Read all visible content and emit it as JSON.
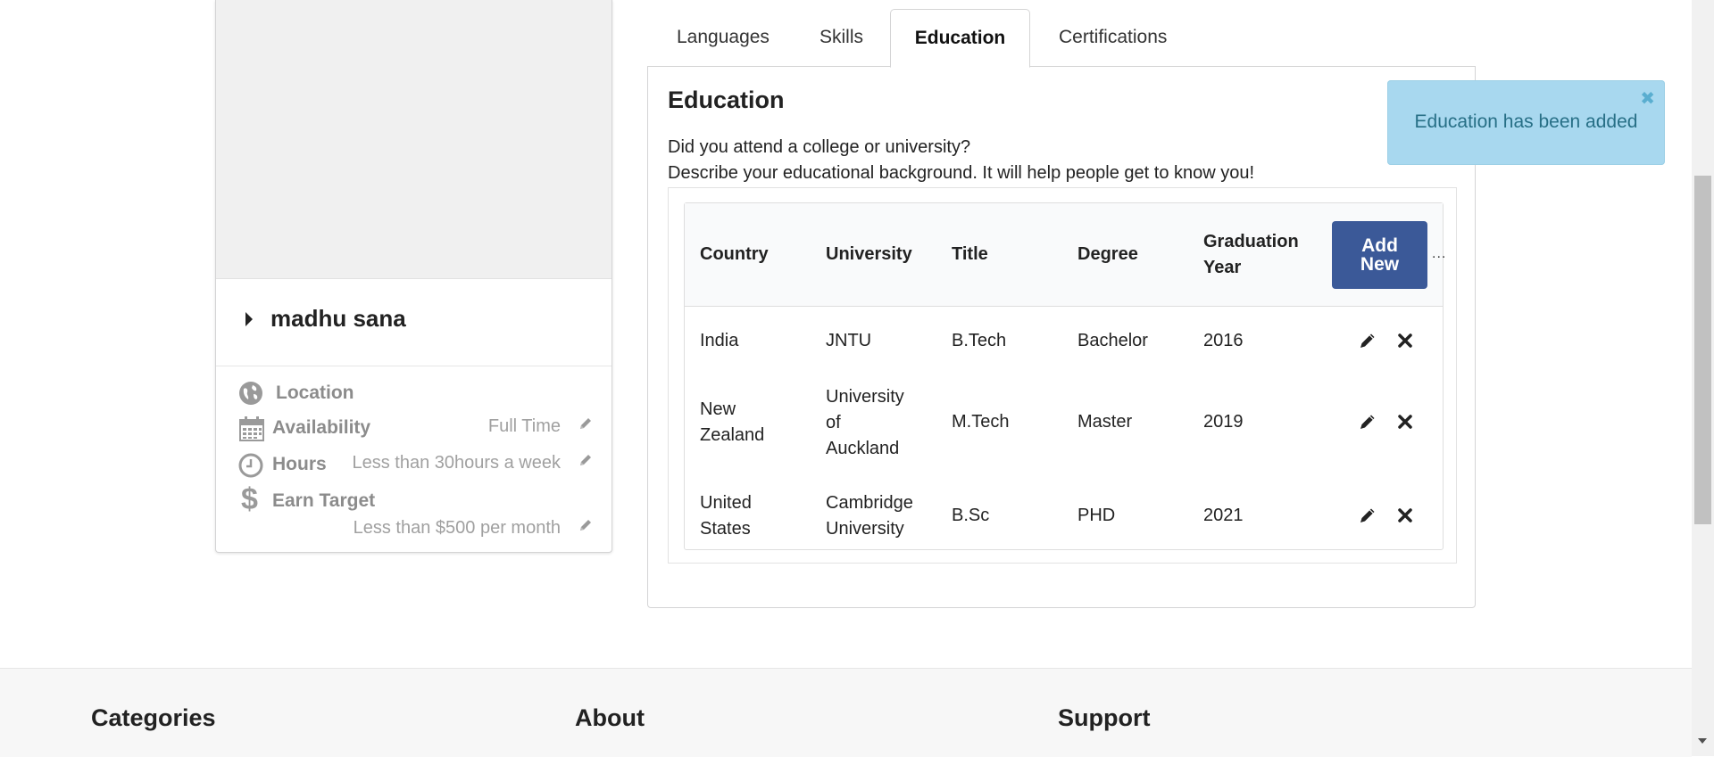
{
  "profile": {
    "name": "madhu sana",
    "location_label": "Location",
    "availability_label": "Availability",
    "availability_value": "Full Time",
    "hours_label": "Hours",
    "hours_value": "Less than 30hours a week",
    "earn_label": "Earn Target",
    "earn_value": "Less than $500 per month"
  },
  "tabs": [
    {
      "label": "Languages"
    },
    {
      "label": "Skills"
    },
    {
      "label": "Education"
    },
    {
      "label": "Certifications"
    }
  ],
  "education": {
    "title": "Education",
    "question": "Did you attend a college or university?",
    "description": "Describe your educational background. It will help people get to know you!",
    "add_button_line1": "Add",
    "add_button_line2": "New",
    "columns": {
      "country": "Country",
      "university": "University",
      "title": "Title",
      "degree": "Degree",
      "year_line1": "Graduation",
      "year_line2": "Year"
    },
    "overflow": "...",
    "rows": [
      {
        "country_l1": "India",
        "country_l2": "",
        "uni_l1": "JNTU",
        "uni_l2": "",
        "uni_l3": "",
        "title": "B.Tech",
        "degree": "Bachelor",
        "year": "2016"
      },
      {
        "country_l1": "New",
        "country_l2": "Zealand",
        "uni_l1": "University",
        "uni_l2": "of",
        "uni_l3": "Auckland",
        "title": "M.Tech",
        "degree": "Master",
        "year": "2019"
      },
      {
        "country_l1": "United",
        "country_l2": "States",
        "uni_l1": "Cambridge",
        "uni_l2": "University",
        "uni_l3": "",
        "title": "B.Sc",
        "degree": "PHD",
        "year": "2021"
      }
    ]
  },
  "toast": {
    "message": "Education has been added",
    "close": "✖"
  },
  "footer": {
    "categories": "Categories",
    "about": "About",
    "support": "Support"
  },
  "colors": {
    "primary_button": "#3b5998",
    "toast_bg": "#a8d8ef",
    "toast_text": "#276f86"
  }
}
